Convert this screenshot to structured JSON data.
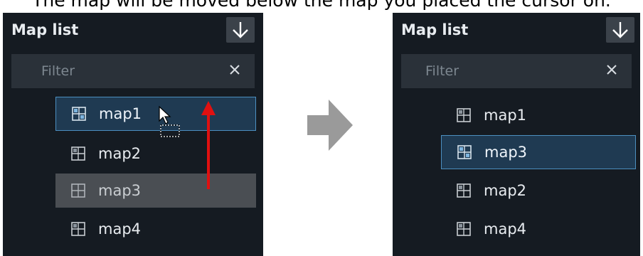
{
  "caption": "The map will be moved below the map you placed the cursor on.",
  "before": {
    "title": "Map list",
    "filter_placeholder": "Filter",
    "items": [
      {
        "label": "map1",
        "state": "selected"
      },
      {
        "label": "map2",
        "state": "normal"
      },
      {
        "label": "map3",
        "state": "dragging"
      },
      {
        "label": "map4",
        "state": "normal"
      }
    ]
  },
  "after": {
    "title": "Map list",
    "filter_placeholder": "Filter",
    "items": [
      {
        "label": "map1",
        "state": "normal"
      },
      {
        "label": "map3",
        "state": "selected"
      },
      {
        "label": "map2",
        "state": "normal"
      },
      {
        "label": "map4",
        "state": "normal"
      }
    ]
  },
  "colors": {
    "panel_bg": "#151b22",
    "filter_bg": "#2a3139",
    "selected_bg": "#1f3a52",
    "selected_border": "#4c8fc0",
    "drag_arrow": "#e01010",
    "transition_arrow": "#9a9a9a"
  },
  "icons": [
    "download-icon",
    "close-icon",
    "map-icon",
    "cursor-move-icon",
    "right-arrow-icon"
  ]
}
